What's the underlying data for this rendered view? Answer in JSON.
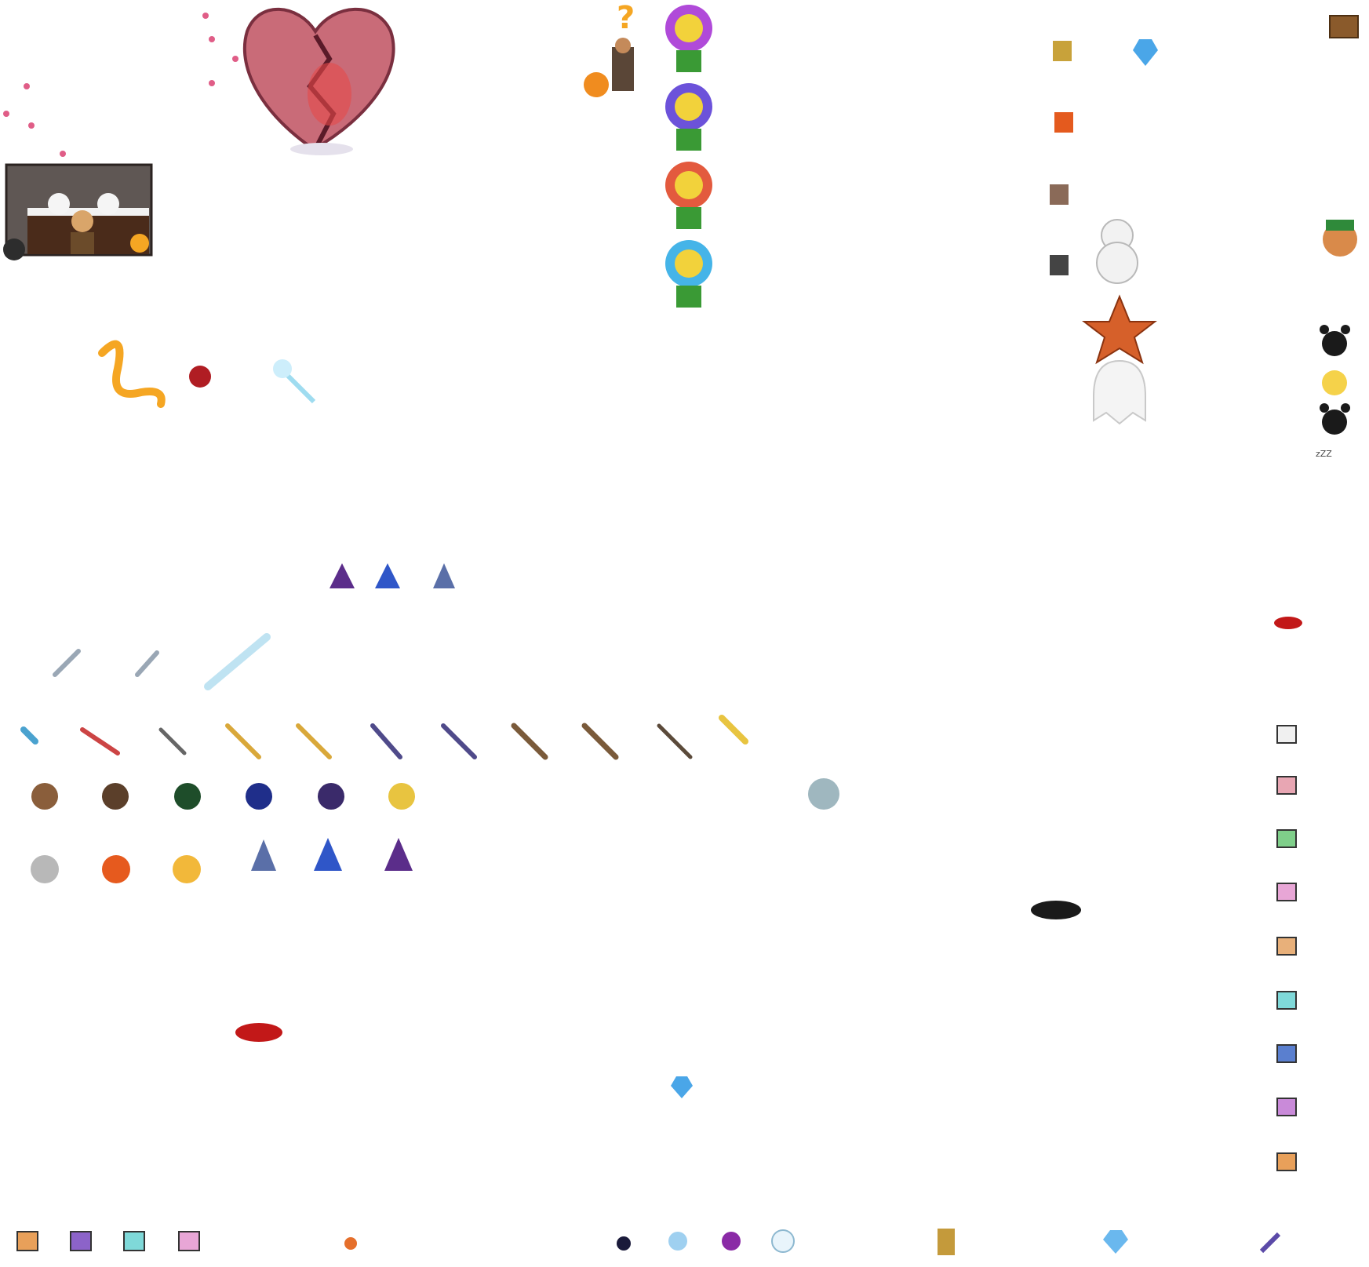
{
  "sheet": {
    "kind": "pixel-art item sprite atlas",
    "background": "#ffffff",
    "sprites": [
      {
        "name": "broken-heart-sprite",
        "icon": "broken-heart",
        "color": "#c25b6d"
      },
      {
        "name": "stable-scene-sprite",
        "icon": "farm-stable",
        "color": "#5d5555"
      },
      {
        "name": "question-mark-npc-sprite",
        "icon": "npc-with-question",
        "color": "#f5a623"
      },
      {
        "name": "smiling-flower-purple-sprite",
        "icon": "potted-flower",
        "color": "#a244d6"
      },
      {
        "name": "smiling-flower-violet-sprite",
        "icon": "potted-flower",
        "color": "#6b53d9"
      },
      {
        "name": "smiling-flower-red-sprite",
        "icon": "potted-flower",
        "color": "#e0583d"
      },
      {
        "name": "smiling-flower-blue-sprite",
        "icon": "potted-flower",
        "color": "#46b4e8"
      },
      {
        "name": "snowman-sprite",
        "icon": "snowman",
        "color": "#f2f2f2"
      },
      {
        "name": "starfish-sprite",
        "icon": "starfish",
        "color": "#d6602a"
      },
      {
        "name": "ghost-sprite",
        "icon": "ghost",
        "color": "#f4f4f4"
      },
      {
        "name": "leprechaun-sprite",
        "icon": "leprechaun",
        "color": "#2f8a3a"
      },
      {
        "name": "fire-whip-sprite",
        "icon": "fire-swirl",
        "color": "#f5a623"
      },
      {
        "name": "ice-wand-sprite",
        "icon": "snowflake-wand",
        "color": "#9fdcf0"
      },
      {
        "name": "rose-bouquet-sprite",
        "icon": "rose",
        "color": "#b01d23"
      },
      {
        "name": "gift-box-sprite",
        "icon": "gift",
        "color": "#8c63c9"
      },
      {
        "name": "diamond-sprite",
        "icon": "diamond",
        "color": "#6ab8ee"
      },
      {
        "name": "potion-flask-sprite",
        "icon": "flask",
        "color": "#e56f2b"
      },
      {
        "name": "hourglass-sprite",
        "icon": "hourglass",
        "color": "#c49a3b"
      },
      {
        "name": "gold-key-sprite",
        "icon": "key",
        "color": "#5b4aa8"
      },
      {
        "name": "treasure-chest-sprite",
        "icon": "chest",
        "color": "#8a5a2b"
      },
      {
        "name": "paw-print-sprite",
        "icon": "paw-print",
        "color": "#1a1a1a"
      },
      {
        "name": "sword-sprite",
        "icon": "sword",
        "color": "#9aa7b5"
      },
      {
        "name": "staff-sprite",
        "icon": "staff",
        "color": "#7a5a3a"
      },
      {
        "name": "wizard-hat-sprite",
        "icon": "wizard-hat",
        "color": "#3f63c8"
      },
      {
        "name": "helmet-sprite",
        "icon": "helmet",
        "color": "#8d8d8d"
      },
      {
        "name": "hair-sprite",
        "icon": "hair",
        "color": "#6b4a2f"
      },
      {
        "name": "shield-sprite",
        "icon": "shield",
        "color": "#c8a23a"
      },
      {
        "name": "eyes-sprite",
        "icon": "eyes",
        "color": "#222222"
      },
      {
        "name": "mouth-sprite",
        "icon": "lips",
        "color": "#c21818"
      },
      {
        "name": "ring-sprite",
        "icon": "ring",
        "color": "#444444"
      }
    ],
    "text": {
      "question_mark": "?",
      "sleep_zzz": "zZZ",
      "dots": ". . ."
    }
  }
}
